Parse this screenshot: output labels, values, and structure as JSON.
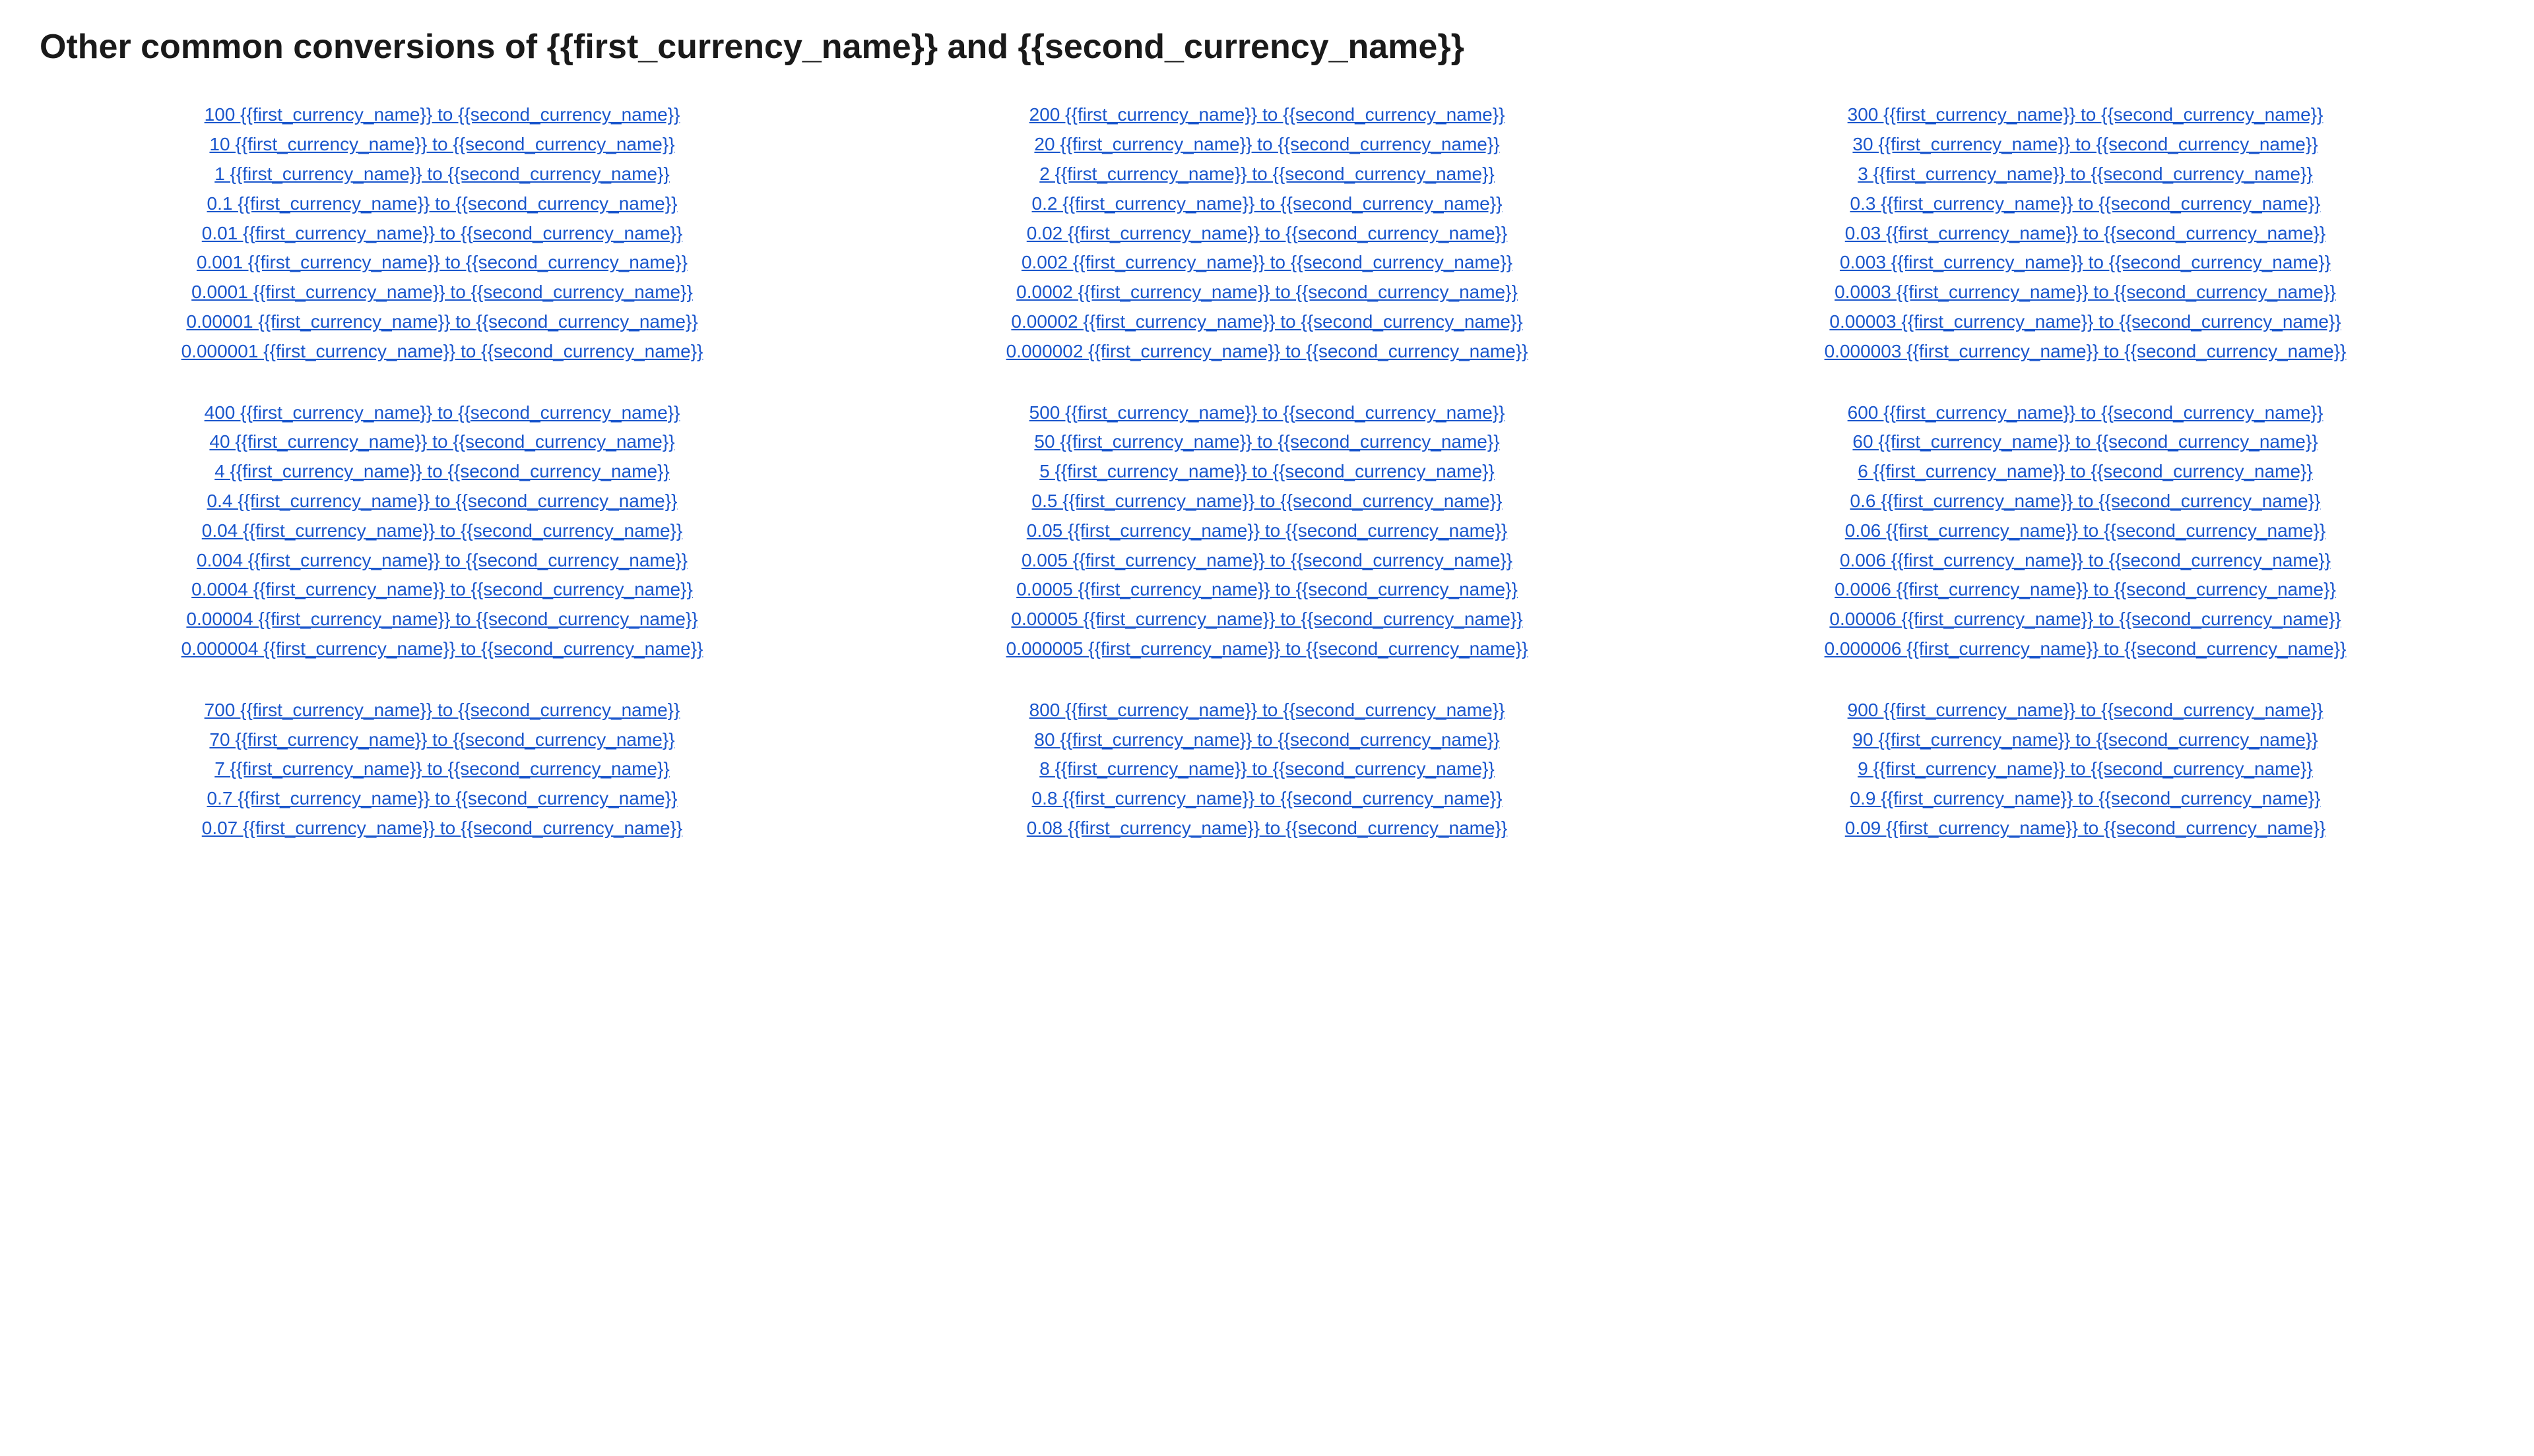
{
  "page": {
    "title": "Other common conversions of {{first_currency_name}} and {{second_currency_name}}"
  },
  "link_color": "#1a56cc",
  "columns": [
    {
      "groups": [
        {
          "links": [
            "100 {{first_currency_name}} to {{second_currency_name}}",
            "10 {{first_currency_name}} to {{second_currency_name}}",
            "1 {{first_currency_name}} to {{second_currency_name}}",
            "0.1 {{first_currency_name}} to {{second_currency_name}}",
            "0.01 {{first_currency_name}} to {{second_currency_name}}",
            "0.001 {{first_currency_name}} to {{second_currency_name}}",
            "0.0001 {{first_currency_name}} to {{second_currency_name}}",
            "0.00001 {{first_currency_name}} to {{second_currency_name}}",
            "0.000001 {{first_currency_name}} to {{second_currency_name}}"
          ]
        },
        {
          "links": [
            "400 {{first_currency_name}} to {{second_currency_name}}",
            "40 {{first_currency_name}} to {{second_currency_name}}",
            "4 {{first_currency_name}} to {{second_currency_name}}",
            "0.4 {{first_currency_name}} to {{second_currency_name}}",
            "0.04 {{first_currency_name}} to {{second_currency_name}}",
            "0.004 {{first_currency_name}} to {{second_currency_name}}",
            "0.0004 {{first_currency_name}} to {{second_currency_name}}",
            "0.00004 {{first_currency_name}} to {{second_currency_name}}",
            "0.000004 {{first_currency_name}} to {{second_currency_name}}"
          ]
        },
        {
          "links": [
            "700 {{first_currency_name}} to {{second_currency_name}}",
            "70 {{first_currency_name}} to {{second_currency_name}}",
            "7 {{first_currency_name}} to {{second_currency_name}}",
            "0.7 {{first_currency_name}} to {{second_currency_name}}",
            "0.07 {{first_currency_name}} to {{second_currency_name}}"
          ]
        }
      ]
    },
    {
      "groups": [
        {
          "links": [
            "200 {{first_currency_name}} to {{second_currency_name}}",
            "20 {{first_currency_name}} to {{second_currency_name}}",
            "2 {{first_currency_name}} to {{second_currency_name}}",
            "0.2 {{first_currency_name}} to {{second_currency_name}}",
            "0.02 {{first_currency_name}} to {{second_currency_name}}",
            "0.002 {{first_currency_name}} to {{second_currency_name}}",
            "0.0002 {{first_currency_name}} to {{second_currency_name}}",
            "0.00002 {{first_currency_name}} to {{second_currency_name}}",
            "0.000002 {{first_currency_name}} to {{second_currency_name}}"
          ]
        },
        {
          "links": [
            "500 {{first_currency_name}} to {{second_currency_name}}",
            "50 {{first_currency_name}} to {{second_currency_name}}",
            "5 {{first_currency_name}} to {{second_currency_name}}",
            "0.5 {{first_currency_name}} to {{second_currency_name}}",
            "0.05 {{first_currency_name}} to {{second_currency_name}}",
            "0.005 {{first_currency_name}} to {{second_currency_name}}",
            "0.0005 {{first_currency_name}} to {{second_currency_name}}",
            "0.00005 {{first_currency_name}} to {{second_currency_name}}",
            "0.000005 {{first_currency_name}} to {{second_currency_name}}"
          ]
        },
        {
          "links": [
            "800 {{first_currency_name}} to {{second_currency_name}}",
            "80 {{first_currency_name}} to {{second_currency_name}}",
            "8 {{first_currency_name}} to {{second_currency_name}}",
            "0.8 {{first_currency_name}} to {{second_currency_name}}",
            "0.08 {{first_currency_name}} to {{second_currency_name}}"
          ]
        }
      ]
    },
    {
      "groups": [
        {
          "links": [
            "300 {{first_currency_name}} to {{second_currency_name}}",
            "30 {{first_currency_name}} to {{second_currency_name}}",
            "3 {{first_currency_name}} to {{second_currency_name}}",
            "0.3 {{first_currency_name}} to {{second_currency_name}}",
            "0.03 {{first_currency_name}} to {{second_currency_name}}",
            "0.003 {{first_currency_name}} to {{second_currency_name}}",
            "0.0003 {{first_currency_name}} to {{second_currency_name}}",
            "0.00003 {{first_currency_name}} to {{second_currency_name}}",
            "0.000003 {{first_currency_name}} to {{second_currency_name}}"
          ]
        },
        {
          "links": [
            "600 {{first_currency_name}} to {{second_currency_name}}",
            "60 {{first_currency_name}} to {{second_currency_name}}",
            "6 {{first_currency_name}} to {{second_currency_name}}",
            "0.6 {{first_currency_name}} to {{second_currency_name}}",
            "0.06 {{first_currency_name}} to {{second_currency_name}}",
            "0.006 {{first_currency_name}} to {{second_currency_name}}",
            "0.0006 {{first_currency_name}} to {{second_currency_name}}",
            "0.00006 {{first_currency_name}} to {{second_currency_name}}",
            "0.000006 {{first_currency_name}} to {{second_currency_name}}"
          ]
        },
        {
          "links": [
            "900 {{first_currency_name}} to {{second_currency_name}}",
            "90 {{first_currency_name}} to {{second_currency_name}}",
            "9 {{first_currency_name}} to {{second_currency_name}}",
            "0.9 {{first_currency_name}} to {{second_currency_name}}",
            "0.09 {{first_currency_name}} to {{second_currency_name}}"
          ]
        }
      ]
    }
  ]
}
